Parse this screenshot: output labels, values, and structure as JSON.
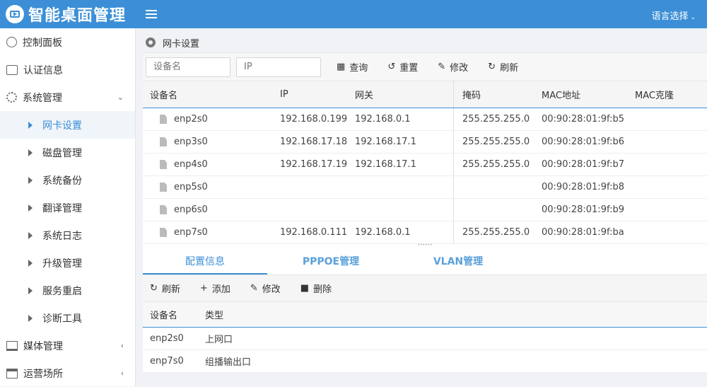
{
  "header": {
    "title": "智能桌面管理",
    "lang_label": "语言选择"
  },
  "sidebar": {
    "items": [
      {
        "label": "控制面板",
        "icon": "gauge-icon"
      },
      {
        "label": "认证信息",
        "icon": "id-card-icon"
      },
      {
        "label": "系统管理",
        "icon": "gear-icon"
      }
    ],
    "sub_items": [
      "网卡设置",
      "磁盘管理",
      "系统备份",
      "翻译管理",
      "系统日志",
      "升级管理",
      "服务重启",
      "诊断工具"
    ],
    "bottom_items": [
      {
        "label": "媒体管理",
        "icon": "monitor-icon"
      },
      {
        "label": "运营场所",
        "icon": "building-icon"
      }
    ]
  },
  "panel": {
    "title": "网卡设置"
  },
  "toolbar": {
    "device_placeholder": "设备名",
    "ip_placeholder": "IP",
    "query": "查询",
    "reset": "重置",
    "edit": "修改",
    "refresh": "刷新"
  },
  "nic_table": {
    "headers": [
      "设备名",
      "IP",
      "网关",
      "掩码",
      "MAC地址",
      "MAC克隆"
    ],
    "rows": [
      [
        "enp2s0",
        "192.168.0.199",
        "192.168.0.1",
        "255.255.255.0",
        "00:90:28:01:9f:b5",
        ""
      ],
      [
        "enp3s0",
        "192.168.17.18",
        "192.168.17.1",
        "255.255.255.0",
        "00:90:28:01:9f:b6",
        ""
      ],
      [
        "enp4s0",
        "192.168.17.19",
        "192.168.17.1",
        "255.255.255.0",
        "00:90:28:01:9f:b7",
        ""
      ],
      [
        "enp5s0",
        "",
        "",
        "",
        "00:90:28:01:9f:b8",
        ""
      ],
      [
        "enp6s0",
        "",
        "",
        "",
        "00:90:28:01:9f:b9",
        ""
      ],
      [
        "enp7s0",
        "192.168.0.111",
        "192.168.0.1",
        "255.255.255.0",
        "00:90:28:01:9f:ba",
        ""
      ]
    ]
  },
  "tabs": [
    "配置信息",
    "PPPOE管理",
    "VLAN管理"
  ],
  "toolbar2": {
    "refresh": "刷新",
    "add": "添加",
    "edit": "修改",
    "delete": "删除"
  },
  "config_table": {
    "headers": [
      "设备名",
      "类型"
    ],
    "rows": [
      [
        "enp2s0",
        "上网口"
      ],
      [
        "enp7s0",
        "组播输出口"
      ]
    ]
  }
}
